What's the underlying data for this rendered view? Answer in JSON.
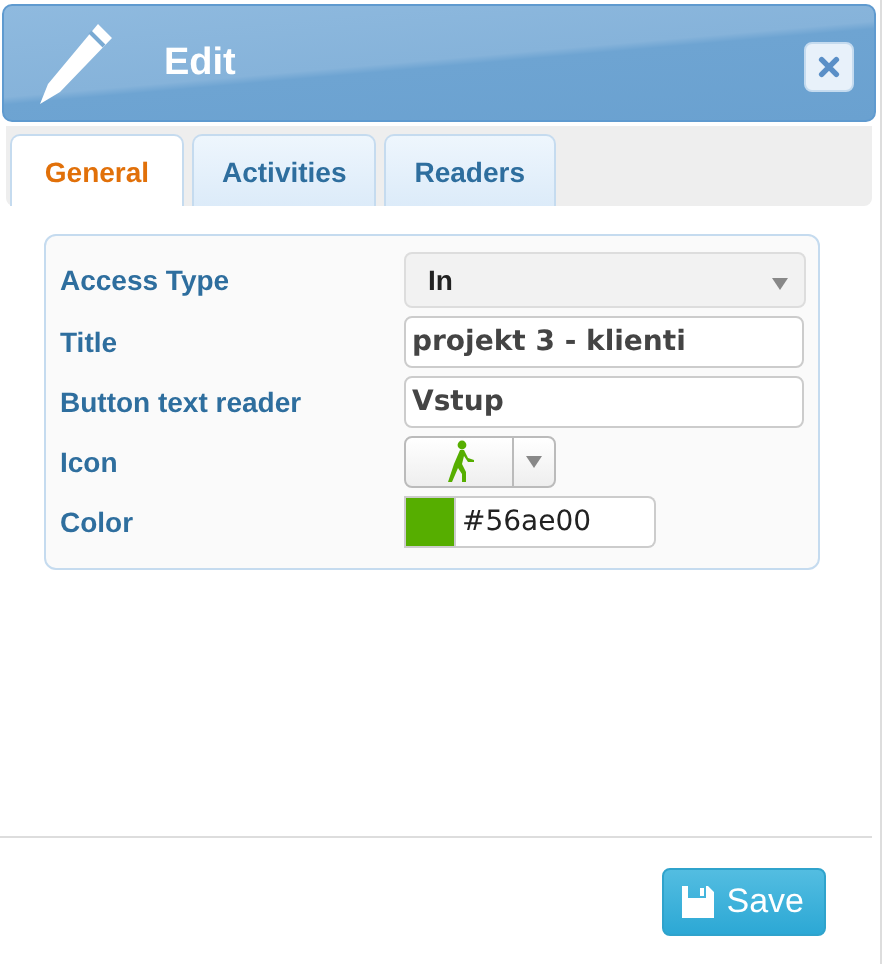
{
  "window": {
    "title": "Edit"
  },
  "tabs": [
    {
      "label": "General",
      "selected": true
    },
    {
      "label": "Activities",
      "selected": false
    },
    {
      "label": "Readers",
      "selected": false
    }
  ],
  "fields": [
    {
      "kind": "select",
      "label": "Access Type",
      "value": "In"
    },
    {
      "kind": "text",
      "label": "Title",
      "value": "projekt 3 - klienti"
    },
    {
      "kind": "text",
      "label": "Button text reader",
      "value": "Vstup"
    },
    {
      "kind": "icon-select",
      "label": "Icon"
    },
    {
      "kind": "color",
      "label": "Color",
      "value": "#56ae00",
      "color": "#56ae00"
    }
  ],
  "buttons": [
    {
      "label": "Save"
    }
  ]
}
